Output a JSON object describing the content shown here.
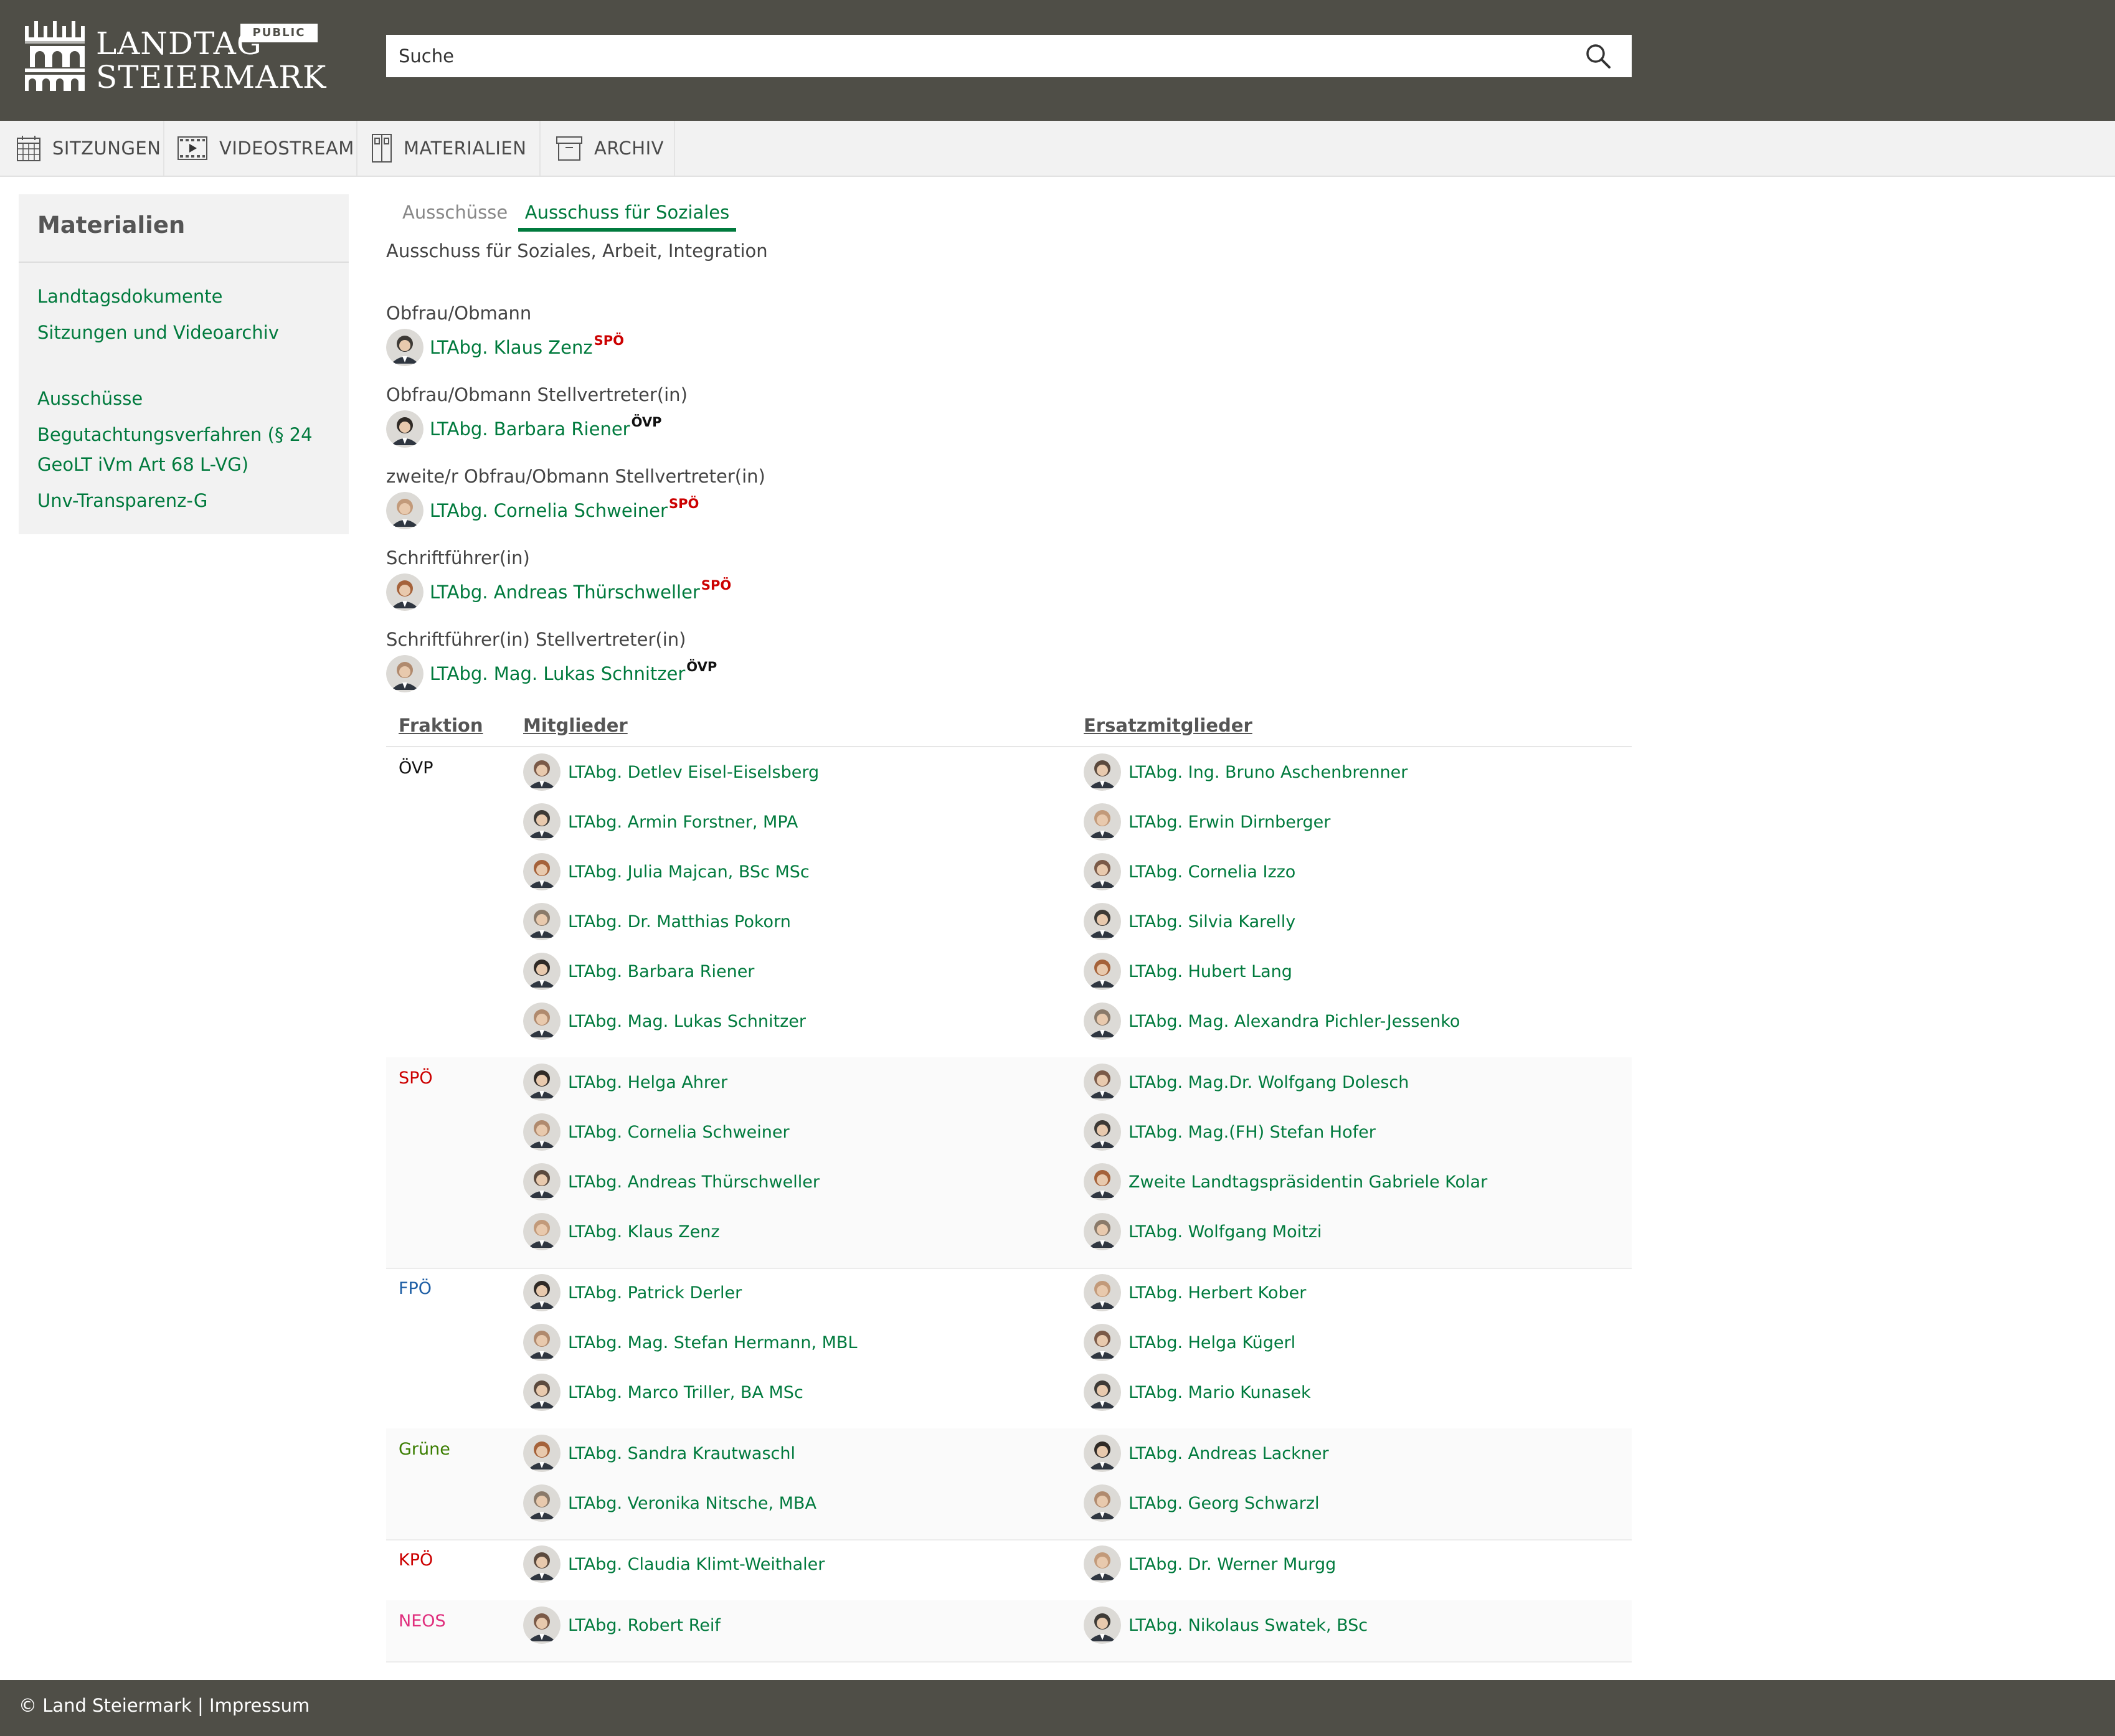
{
  "header": {
    "logo_line1": "LANDTAG",
    "logo_line2": "STEIERMARK",
    "badge": "PUBLIC",
    "search_placeholder": "Suche"
  },
  "nav": {
    "items": [
      {
        "label": "SITZUNGEN",
        "icon": "calendar-icon"
      },
      {
        "label": "VIDEOSTREAM",
        "icon": "video-icon"
      },
      {
        "label": "MATERIALIEN",
        "icon": "documents-icon"
      },
      {
        "label": "ARCHIV",
        "icon": "archive-box-icon"
      }
    ]
  },
  "sidebar": {
    "title": "Materialien",
    "links": [
      "Landtagsdokumente",
      "Sitzungen und Videoarchiv",
      "Ausschüsse",
      "Begutachtungsverfahren (§ 24 GeoLT iVm Art 68 L-VG)",
      "Unv-Transparenz-G"
    ]
  },
  "tabs": [
    "Ausschüsse",
    "Ausschuss für Soziales"
  ],
  "subtitle": "Ausschuss für Soziales, Arbeit, Integration",
  "roles": [
    {
      "label": "Obfrau/Obmann",
      "name": "LTAbg. Klaus Zenz",
      "party": "SPÖ"
    },
    {
      "label": "Obfrau/Obmann Stellvertreter(in)",
      "name": "LTAbg. Barbara Riener",
      "party": "ÖVP"
    },
    {
      "label": "zweite/r Obfrau/Obmann Stellvertreter(in)",
      "name": "LTAbg. Cornelia Schweiner",
      "party": "SPÖ"
    },
    {
      "label": "Schriftführer(in)",
      "name": "LTAbg. Andreas Thürschweller",
      "party": "SPÖ"
    },
    {
      "label": "Schriftführer(in) Stellvertreter(in)",
      "name": "LTAbg. Mag. Lukas Schnitzer",
      "party": "ÖVP"
    }
  ],
  "table": {
    "headers": [
      "Fraktion",
      "Mitglieder",
      "Ersatzmitglieder"
    ],
    "groups": [
      {
        "fraktion": "ÖVP",
        "color": "#111111",
        "mitglieder": [
          "LTAbg. Detlev Eisel-Eiselsberg",
          "LTAbg. Armin Forstner, MPA",
          "LTAbg. Julia Majcan, BSc MSc",
          "LTAbg. Dr. Matthias Pokorn",
          "LTAbg. Barbara Riener",
          "LTAbg. Mag. Lukas Schnitzer"
        ],
        "ersatz": [
          "LTAbg. Ing. Bruno Aschenbrenner",
          "LTAbg. Erwin Dirnberger",
          "LTAbg. Cornelia Izzo",
          "LTAbg. Silvia Karelly",
          "LTAbg. Hubert Lang",
          "LTAbg. Mag. Alexandra Pichler-Jessenko"
        ]
      },
      {
        "fraktion": "SPÖ",
        "color": "#cc0000",
        "mitglieder": [
          "LTAbg. Helga Ahrer",
          "LTAbg. Cornelia Schweiner",
          "LTAbg. Andreas Thürschweller",
          "LTAbg. Klaus Zenz"
        ],
        "ersatz": [
          "LTAbg. Mag.Dr. Wolfgang Dolesch",
          "LTAbg. Mag.(FH) Stefan Hofer",
          "Zweite Landtagspräsidentin Gabriele Kolar",
          "LTAbg. Wolfgang Moitzi"
        ]
      },
      {
        "fraktion": "FPÖ",
        "color": "#1f5fa5",
        "mitglieder": [
          "LTAbg. Patrick Derler",
          "LTAbg. Mag. Stefan Hermann, MBL",
          "LTAbg. Marco Triller, BA MSc"
        ],
        "ersatz": [
          "LTAbg. Herbert Kober",
          "LTAbg. Helga Kügerl",
          "LTAbg. Mario Kunasek"
        ]
      },
      {
        "fraktion": "Grüne",
        "color": "#3a7d00",
        "mitglieder": [
          "LTAbg. Sandra Krautwaschl",
          "LTAbg. Veronika Nitsche, MBA"
        ],
        "ersatz": [
          "LTAbg. Andreas Lackner",
          "LTAbg. Georg Schwarzl"
        ]
      },
      {
        "fraktion": "KPÖ",
        "color": "#cc0000",
        "mitglieder": [
          "LTAbg. Claudia Klimt-Weithaler"
        ],
        "ersatz": [
          "LTAbg. Dr. Werner Murgg"
        ]
      },
      {
        "fraktion": "NEOS",
        "color": "#e0307e",
        "mitglieder": [
          "LTAbg. Robert Reif"
        ],
        "ersatz": [
          "LTAbg. Nikolaus Swatek, BSc"
        ]
      }
    ]
  },
  "footer": {
    "text": "© Land Steiermark | Impressum"
  }
}
